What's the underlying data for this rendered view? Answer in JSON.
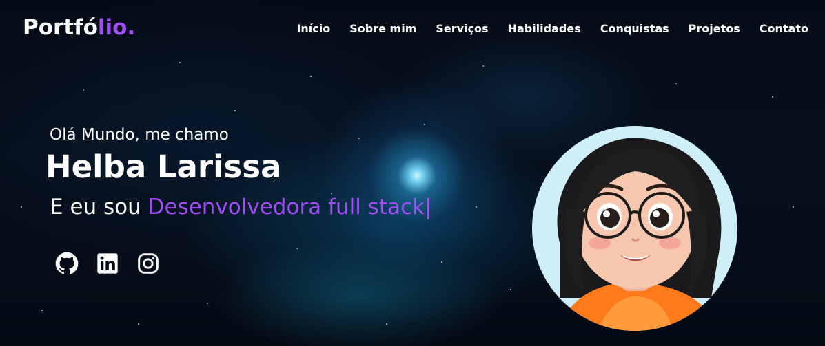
{
  "header": {
    "logo_main": "Portfó",
    "logo_accent": "lio.",
    "nav": [
      {
        "label": "Início"
      },
      {
        "label": "Sobre mim"
      },
      {
        "label": "Serviços"
      },
      {
        "label": "Habilidades"
      },
      {
        "label": "Conquistas"
      },
      {
        "label": "Projetos"
      },
      {
        "label": "Contato"
      }
    ]
  },
  "hero": {
    "greeting": "Olá Mundo, me chamo",
    "name": "Helba Larissa",
    "role_prefix": "E eu sou",
    "role_typed": "Desenvolvedora full stack",
    "cursor": "|"
  },
  "socials": [
    {
      "icon": "github-icon"
    },
    {
      "icon": "linkedin-icon"
    },
    {
      "icon": "instagram-icon"
    }
  ],
  "colors": {
    "accent": "#a14df2",
    "background": "#050b16",
    "avatar_bg": "#cfeff8"
  }
}
